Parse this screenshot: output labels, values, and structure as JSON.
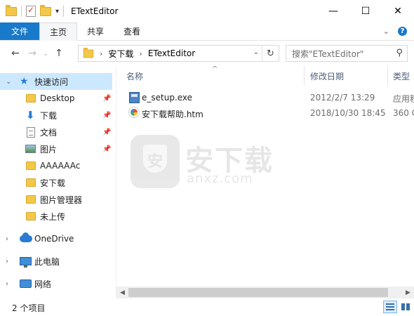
{
  "window": {
    "title": "ETextEditor",
    "controls": {
      "minimize": "—",
      "maximize": "☐",
      "close": "✕"
    }
  },
  "ribbon": {
    "tabs": [
      {
        "label": "文件"
      },
      {
        "label": "主页"
      },
      {
        "label": "共享"
      },
      {
        "label": "查看"
      }
    ],
    "active_tab": "主页",
    "expand_glyph": "⌄"
  },
  "nav": {
    "back": "←",
    "forward": "→",
    "recent": "⌄",
    "up": "↑",
    "address": {
      "crumbs": [
        "安下载",
        "ETextEditor"
      ],
      "separator": "›",
      "refresh": "↻"
    },
    "search": {
      "placeholder": "搜索\"ETextEditor\""
    }
  },
  "sidebar": {
    "items": [
      {
        "label": "快速访问",
        "icon": "star-icon",
        "pinned": false
      },
      {
        "label": "Desktop",
        "icon": "folder-icon",
        "pinned": true
      },
      {
        "label": "下载",
        "icon": "download-icon",
        "pinned": true
      },
      {
        "label": "文档",
        "icon": "document-icon",
        "pinned": true
      },
      {
        "label": "图片",
        "icon": "pictures-icon",
        "pinned": true
      },
      {
        "label": "AAAAAAc",
        "icon": "folder-icon",
        "pinned": false
      },
      {
        "label": "安下载",
        "icon": "folder-icon",
        "pinned": false
      },
      {
        "label": "图片管理器",
        "icon": "folder-icon",
        "pinned": false
      },
      {
        "label": "未上传",
        "icon": "folder-icon",
        "pinned": false
      },
      {
        "label": "OneDrive",
        "icon": "cloud-icon",
        "pinned": false
      },
      {
        "label": "此电脑",
        "icon": "computer-icon",
        "pinned": false
      },
      {
        "label": "网络",
        "icon": "network-icon",
        "pinned": false
      }
    ]
  },
  "files": {
    "columns": [
      "名称",
      "修改日期",
      "类型"
    ],
    "rows": [
      {
        "name": "e_setup.exe",
        "modified": "2012/2/7 13:29",
        "type": "应用程",
        "icon": "exe-icon"
      },
      {
        "name": "安下载帮助.htm",
        "modified": "2018/10/30 18:45",
        "type": "360 C",
        "icon": "htm-icon"
      }
    ]
  },
  "watermark": {
    "text": "安下载",
    "sub": "anxz.com",
    "shield_letter": "安"
  },
  "status": {
    "count": "2 个项目"
  },
  "colors": {
    "accent": "#1979ca",
    "selection": "#cce8ff"
  }
}
